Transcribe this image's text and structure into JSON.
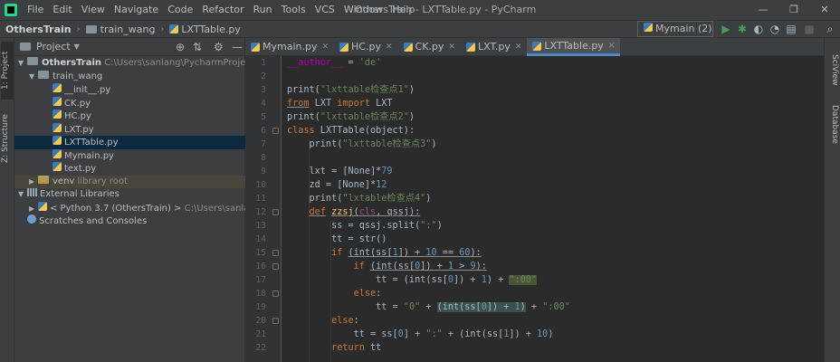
{
  "menu": [
    "File",
    "Edit",
    "View",
    "Navigate",
    "Code",
    "Refactor",
    "Run",
    "Tools",
    "VCS",
    "Window",
    "Help"
  ],
  "window_title": "OthersTrain - LXTTable.py - PyCharm",
  "window_controls": {
    "minimize": "—",
    "maximize": "❐",
    "close": "✕"
  },
  "breadcrumbs": {
    "project": "OthersTrain",
    "folder": "train_wang",
    "file": "LXTTable.py"
  },
  "run_config": "Mymain (2)",
  "left_tabs": {
    "project": "1: Project",
    "structure": "Z: Structure"
  },
  "right_tabs": {
    "sciview": "SciView",
    "database": "Database"
  },
  "project_panel": {
    "title": "Project",
    "tree": [
      {
        "text": "OthersTrain",
        "extra": "C:\\Users\\sanlang\\PycharmProjects\\Others"
      },
      {
        "text": "train_wang"
      },
      {
        "text": "__init__.py"
      },
      {
        "text": "CK.py"
      },
      {
        "text": "HC.py"
      },
      {
        "text": "LXT.py"
      },
      {
        "text": "LXTTable.py"
      },
      {
        "text": "Mymain.py"
      },
      {
        "text": "text.py"
      },
      {
        "text": "venv",
        "extra": "library root"
      },
      {
        "text": "External Libraries"
      },
      {
        "text": "< Python 3.7 (OthersTrain) >",
        "extra": "C:\\Users\\sanlang\\Pych"
      },
      {
        "text": "Scratches and Consoles"
      }
    ]
  },
  "tabs": [
    {
      "label": "Mymain.py"
    },
    {
      "label": "HC.py"
    },
    {
      "label": "CK.py"
    },
    {
      "label": "LXT.py"
    },
    {
      "label": "LXTTable.py",
      "active": true
    }
  ],
  "editor": {
    "line_numbers": [
      "1",
      "2",
      "3",
      "4",
      "5",
      "6",
      "7",
      "8",
      "9",
      "10",
      "11",
      "12",
      "13",
      "14",
      "15",
      "16",
      "17",
      "18",
      "19",
      "20",
      "21",
      "22"
    ],
    "code": {
      "l1_a": "__author__",
      "l1_b": " = ",
      "l1_c": "'de'",
      "l3_a": "print(",
      "l3_b": "\"lxttable检查点1\"",
      "l3_c": ")",
      "l4_a": "from",
      "l4_b": " LXT ",
      "l4_c": "import",
      "l4_d": " LXT",
      "l5_a": "print(",
      "l5_b": "\"lxttable检查点2\"",
      "l5_c": ")",
      "l6_a": "class",
      "l6_b": " LXTTable(object):",
      "l7_a": "    print(",
      "l7_b": "\"lxttable检查点3\"",
      "l7_c": ")",
      "l9_a": "    lxt = [None]*",
      "l9_b": "79",
      "l10_a": "    zd = [None]*",
      "l10_b": "12",
      "l11_a": "    print(",
      "l11_b": "\"lxtable检查点4\"",
      "l11_c": ")",
      "l12_a": "    ",
      "l12_b": "def",
      "l12_c": "zzsj",
      "l12_d": "(",
      "l12_e": "cls",
      "l12_f": ", qssj):",
      "l13_a": "        ss = qssj.split(",
      "l13_b": "\":\"",
      "l13_c": ")",
      "l14_a": "        tt = str()",
      "l15_a": "        ",
      "l15_b": "if",
      "l15_c": "(int(ss[",
      "l15_d": "1",
      "l15_e": "]) + ",
      "l15_f": "10",
      "l15_g": " == ",
      "l15_h": "60",
      "l15_i": "):",
      "l16_a": "            ",
      "l16_b": "if",
      "l16_c": "(int(ss[",
      "l16_d": "0",
      "l16_e": "]) + ",
      "l16_f": "1",
      "l16_g": " > ",
      "l16_h": "9",
      "l16_i": "):",
      "l17_a": "                tt = (int(ss[",
      "l17_b": "0",
      "l17_c": "]) + ",
      "l17_d": "1",
      "l17_e": ") + ",
      "l17_f": "\":00\"",
      "l18_a": "            ",
      "l18_b": "else",
      "l18_c": ":",
      "l19_a": "                tt = ",
      "l19_b": "\"0\"",
      "l19_c": " + ",
      "l19_d": "(int(ss[",
      "l19_e": "0",
      "l19_f": "]) + ",
      "l19_g": "1",
      "l19_h": ")",
      "l19_i": " + ",
      "l19_j": "\":00\"",
      "l20_a": "        ",
      "l20_b": "else",
      "l20_c": ":",
      "l21_a": "            tt = ss[",
      "l21_b": "0",
      "l21_c": "] + ",
      "l21_d": "\":\"",
      "l21_e": " + (int(ss[",
      "l21_f": "1",
      "l21_g": "]) + ",
      "l21_h": "10",
      "l21_i": ")",
      "l22_a": "        ",
      "l22_b": "return",
      "l22_c": " tt"
    }
  }
}
